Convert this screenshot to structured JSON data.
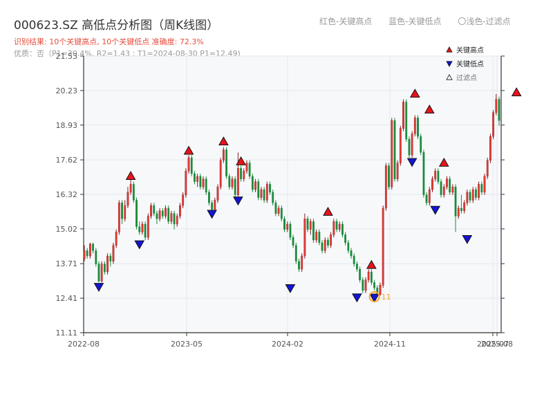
{
  "header": {
    "title": "000623.SZ 高低点分析图（周K线图）",
    "result": "识别结果: 10个关键高点, 10个关键低点  准确度: 72.3%",
    "meta": "优质：否（P1=30.4%, R2=1.43 ; T1=2024-08-30 P1=12.49)"
  },
  "top_legend": [
    "红色-关键高点",
    "蓝色-关键低点",
    "〇浅色-过滤点"
  ],
  "colors": {
    "up": "#e53935",
    "down": "#1a8a3a",
    "high": "#e8141c",
    "low": "#1414d4",
    "highlight": "#f5a623",
    "grid": "#e3e8ee",
    "plot_bg": "#f7f8fa"
  },
  "chart_data": {
    "type": "candlestick",
    "y_ticks": [
      "11.11",
      "12.41",
      "13.71",
      "15.02",
      "16.32",
      "17.62",
      "18.93",
      "20.23",
      "21.53"
    ],
    "ylim": [
      11.11,
      21.53
    ],
    "x_ticks": [
      "2022-08",
      "2023-05",
      "2024-02",
      "2024-11",
      "2025-07",
      "2025-08"
    ],
    "legend": [
      {
        "symbol": "▲",
        "label": "关键高点"
      },
      {
        "symbol": "▼",
        "label": "关键低点"
      },
      {
        "symbol": "△",
        "label": "过滤点"
      }
    ],
    "highlight_point": {
      "label": "11",
      "value": 12.49
    },
    "key_highs": [
      16.85,
      17.8,
      18.15,
      17.4,
      15.5,
      13.5,
      19.95,
      19.35,
      17.35,
      20.0
    ],
    "key_lows": [
      13.0,
      14.6,
      15.75,
      16.25,
      12.95,
      12.6,
      17.7,
      15.9,
      14.8
    ],
    "candles": [
      [
        13.9,
        14.2,
        14.4,
        13.8
      ],
      [
        14.2,
        14.0,
        14.3,
        13.9
      ],
      [
        14.0,
        14.45,
        14.5,
        13.9
      ],
      [
        14.45,
        14.2,
        14.5,
        14.1
      ],
      [
        14.2,
        13.7,
        14.3,
        13.6
      ],
      [
        13.7,
        13.05,
        13.8,
        13.0
      ],
      [
        13.05,
        13.7,
        13.8,
        13.0
      ],
      [
        13.7,
        13.4,
        13.8,
        13.3
      ],
      [
        13.4,
        14.0,
        14.1,
        13.3
      ],
      [
        14.0,
        13.8,
        14.1,
        13.6
      ],
      [
        13.8,
        14.4,
        14.5,
        13.7
      ],
      [
        14.4,
        14.9,
        15.0,
        14.3
      ],
      [
        14.9,
        16.0,
        16.1,
        14.8
      ],
      [
        16.0,
        15.4,
        16.1,
        15.2
      ],
      [
        15.4,
        15.9,
        16.1,
        15.3
      ],
      [
        15.9,
        16.4,
        16.6,
        15.8
      ],
      [
        16.4,
        16.7,
        16.9,
        16.3
      ],
      [
        16.7,
        16.1,
        16.8,
        16.0
      ],
      [
        16.1,
        15.1,
        16.2,
        15.0
      ],
      [
        15.1,
        14.9,
        15.3,
        14.8
      ],
      [
        14.9,
        15.2,
        15.3,
        14.8
      ],
      [
        15.2,
        14.7,
        15.3,
        14.6
      ],
      [
        14.7,
        15.5,
        15.6,
        14.6
      ],
      [
        15.5,
        15.9,
        16.0,
        15.4
      ],
      [
        15.9,
        15.6,
        16.0,
        15.5
      ],
      [
        15.6,
        15.4,
        15.7,
        15.2
      ],
      [
        15.4,
        15.7,
        15.8,
        15.3
      ],
      [
        15.7,
        15.5,
        15.8,
        15.4
      ],
      [
        15.5,
        15.8,
        15.9,
        15.4
      ],
      [
        15.8,
        15.3,
        15.9,
        15.2
      ],
      [
        15.3,
        15.6,
        15.7,
        15.2
      ],
      [
        15.6,
        15.2,
        15.7,
        15.0
      ],
      [
        15.2,
        15.5,
        15.6,
        15.1
      ],
      [
        15.5,
        15.9,
        16.0,
        15.4
      ],
      [
        15.9,
        16.3,
        16.4,
        15.8
      ],
      [
        16.3,
        17.2,
        17.3,
        16.2
      ],
      [
        17.2,
        17.7,
        17.8,
        17.1
      ],
      [
        17.7,
        17.1,
        17.8,
        17.0
      ],
      [
        17.1,
        16.8,
        17.2,
        16.7
      ],
      [
        16.8,
        17.0,
        17.1,
        16.6
      ],
      [
        17.0,
        16.6,
        17.1,
        16.5
      ],
      [
        16.6,
        16.9,
        17.0,
        16.5
      ],
      [
        16.9,
        16.4,
        17.0,
        16.3
      ],
      [
        16.4,
        16.0,
        16.5,
        15.9
      ],
      [
        16.0,
        15.75,
        16.1,
        15.7
      ],
      [
        15.75,
        16.1,
        16.2,
        15.7
      ],
      [
        16.1,
        16.6,
        16.7,
        16.0
      ],
      [
        16.6,
        17.6,
        17.7,
        16.5
      ],
      [
        17.6,
        18.0,
        18.1,
        17.5
      ],
      [
        18.0,
        17.0,
        18.1,
        16.9
      ],
      [
        17.0,
        16.6,
        17.1,
        16.5
      ],
      [
        16.6,
        16.9,
        17.0,
        16.5
      ],
      [
        16.9,
        16.3,
        17.0,
        16.2
      ],
      [
        16.3,
        17.3,
        17.9,
        16.2
      ],
      [
        17.3,
        16.9,
        17.4,
        16.8
      ],
      [
        16.9,
        17.2,
        17.3,
        16.8
      ],
      [
        17.2,
        17.5,
        17.6,
        17.1
      ],
      [
        17.5,
        17.0,
        17.6,
        16.9
      ],
      [
        17.0,
        16.5,
        17.1,
        16.4
      ],
      [
        16.5,
        16.8,
        16.9,
        16.4
      ],
      [
        16.8,
        16.2,
        16.9,
        16.1
      ],
      [
        16.2,
        16.5,
        16.6,
        16.1
      ],
      [
        16.5,
        16.1,
        16.6,
        16.0
      ],
      [
        16.1,
        16.7,
        16.8,
        16.0
      ],
      [
        16.7,
        16.4,
        16.8,
        16.3
      ],
      [
        16.4,
        16.0,
        16.5,
        15.9
      ],
      [
        16.0,
        15.6,
        16.1,
        15.5
      ],
      [
        15.6,
        15.8,
        15.9,
        15.5
      ],
      [
        15.8,
        15.4,
        15.9,
        15.3
      ],
      [
        15.4,
        15.0,
        15.5,
        14.9
      ],
      [
        15.0,
        15.2,
        15.3,
        14.9
      ],
      [
        15.2,
        14.7,
        15.3,
        14.6
      ],
      [
        14.7,
        14.4,
        14.8,
        14.3
      ],
      [
        14.4,
        13.8,
        14.5,
        13.7
      ],
      [
        13.8,
        13.5,
        13.9,
        13.4
      ],
      [
        13.5,
        14.0,
        14.1,
        13.4
      ],
      [
        14.0,
        15.4,
        15.6,
        13.9
      ],
      [
        15.4,
        15.0,
        15.5,
        14.9
      ],
      [
        15.0,
        15.3,
        15.4,
        14.8
      ],
      [
        15.3,
        14.6,
        15.4,
        14.5
      ],
      [
        14.6,
        14.9,
        15.0,
        14.5
      ],
      [
        14.9,
        14.5,
        15.0,
        14.4
      ],
      [
        14.5,
        14.2,
        14.6,
        14.1
      ],
      [
        14.2,
        14.6,
        14.7,
        14.1
      ],
      [
        14.6,
        14.4,
        14.7,
        14.3
      ],
      [
        14.4,
        14.8,
        14.9,
        14.3
      ],
      [
        14.8,
        15.3,
        15.4,
        14.7
      ],
      [
        15.3,
        15.0,
        15.4,
        14.9
      ],
      [
        15.0,
        15.2,
        15.3,
        14.9
      ],
      [
        15.2,
        14.8,
        15.3,
        14.7
      ],
      [
        14.8,
        14.5,
        14.9,
        14.4
      ],
      [
        14.5,
        14.2,
        14.6,
        14.1
      ],
      [
        14.2,
        14.0,
        14.3,
        13.9
      ],
      [
        14.0,
        13.7,
        14.1,
        13.6
      ],
      [
        13.7,
        13.5,
        13.8,
        13.4
      ],
      [
        13.5,
        13.1,
        13.6,
        13.0
      ],
      [
        13.1,
        12.7,
        13.2,
        12.6
      ],
      [
        12.7,
        13.1,
        13.2,
        12.6
      ],
      [
        13.1,
        13.4,
        13.5,
        13.0
      ],
      [
        13.4,
        13.0,
        13.5,
        12.9
      ],
      [
        13.0,
        12.8,
        13.1,
        12.7
      ],
      [
        12.8,
        12.55,
        12.9,
        12.5
      ],
      [
        12.55,
        12.9,
        13.0,
        12.5
      ],
      [
        12.9,
        15.8,
        15.9,
        12.8
      ],
      [
        15.8,
        17.4,
        17.5,
        15.7
      ],
      [
        17.4,
        16.6,
        17.5,
        16.5
      ],
      [
        16.6,
        19.1,
        19.2,
        16.5
      ],
      [
        19.1,
        16.9,
        19.2,
        16.8
      ],
      [
        16.9,
        17.5,
        17.6,
        16.8
      ],
      [
        17.5,
        18.8,
        18.9,
        17.4
      ],
      [
        18.8,
        19.8,
        19.9,
        18.7
      ],
      [
        19.8,
        18.4,
        19.9,
        18.3
      ],
      [
        18.4,
        17.8,
        18.5,
        17.7
      ],
      [
        17.8,
        18.6,
        18.7,
        17.7
      ],
      [
        18.6,
        19.2,
        19.3,
        18.5
      ],
      [
        19.2,
        18.5,
        19.3,
        18.4
      ],
      [
        18.5,
        17.9,
        18.6,
        17.8
      ],
      [
        17.9,
        16.3,
        18.0,
        16.2
      ],
      [
        16.3,
        16.0,
        16.4,
        15.9
      ],
      [
        16.0,
        16.5,
        16.6,
        15.9
      ],
      [
        16.5,
        16.9,
        17.0,
        16.4
      ],
      [
        16.9,
        17.2,
        17.3,
        16.8
      ],
      [
        17.2,
        16.8,
        17.3,
        16.7
      ],
      [
        16.8,
        16.3,
        16.9,
        16.2
      ],
      [
        16.3,
        16.6,
        16.7,
        16.2
      ],
      [
        16.6,
        16.9,
        17.0,
        16.5
      ],
      [
        16.9,
        16.4,
        17.0,
        16.3
      ],
      [
        16.4,
        16.6,
        16.7,
        16.3
      ],
      [
        16.6,
        15.5,
        16.7,
        14.9
      ],
      [
        15.5,
        15.8,
        15.9,
        15.4
      ],
      [
        15.8,
        15.7,
        16.3,
        15.6
      ],
      [
        15.7,
        16.0,
        16.1,
        15.6
      ],
      [
        16.0,
        16.4,
        16.5,
        15.9
      ],
      [
        16.4,
        16.1,
        16.5,
        16.0
      ],
      [
        16.1,
        16.5,
        16.6,
        16.0
      ],
      [
        16.5,
        16.2,
        16.6,
        16.1
      ],
      [
        16.2,
        16.7,
        16.8,
        16.1
      ],
      [
        16.7,
        16.4,
        16.8,
        16.3
      ],
      [
        16.4,
        17.0,
        17.1,
        16.3
      ],
      [
        17.0,
        17.6,
        17.7,
        16.9
      ],
      [
        17.6,
        18.5,
        18.6,
        17.5
      ],
      [
        18.5,
        19.4,
        19.5,
        18.4
      ],
      [
        19.4,
        19.9,
        20.1,
        19.3
      ],
      [
        19.9,
        19.1,
        20.0,
        18.9
      ]
    ]
  }
}
